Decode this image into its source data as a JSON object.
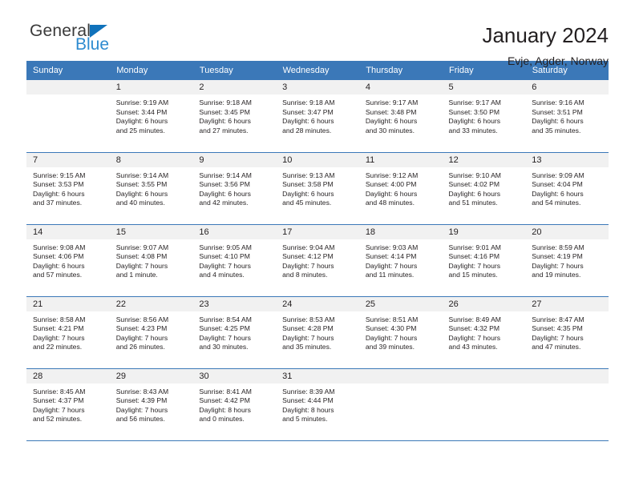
{
  "brand": {
    "name_part1": "General",
    "name_part2": "Blue",
    "triangle_icon": "triangle-icon",
    "accent_color": "#1072bb",
    "text_color": "#2e8bd0"
  },
  "header": {
    "title": "January 2024",
    "subtitle": "Evje, Agder, Norway"
  },
  "calendar": {
    "header_bg": "#3b78b8",
    "daynum_bg": "#f1f1f1",
    "weekdays": [
      "Sunday",
      "Monday",
      "Tuesday",
      "Wednesday",
      "Thursday",
      "Friday",
      "Saturday"
    ],
    "weeks": [
      [
        {
          "day": "",
          "blank": true,
          "sunrise": "",
          "sunset": "",
          "daylight1": "",
          "daylight2": ""
        },
        {
          "day": "1",
          "sunrise": "Sunrise: 9:19 AM",
          "sunset": "Sunset: 3:44 PM",
          "daylight1": "Daylight: 6 hours",
          "daylight2": "and 25 minutes."
        },
        {
          "day": "2",
          "sunrise": "Sunrise: 9:18 AM",
          "sunset": "Sunset: 3:45 PM",
          "daylight1": "Daylight: 6 hours",
          "daylight2": "and 27 minutes."
        },
        {
          "day": "3",
          "sunrise": "Sunrise: 9:18 AM",
          "sunset": "Sunset: 3:47 PM",
          "daylight1": "Daylight: 6 hours",
          "daylight2": "and 28 minutes."
        },
        {
          "day": "4",
          "sunrise": "Sunrise: 9:17 AM",
          "sunset": "Sunset: 3:48 PM",
          "daylight1": "Daylight: 6 hours",
          "daylight2": "and 30 minutes."
        },
        {
          "day": "5",
          "sunrise": "Sunrise: 9:17 AM",
          "sunset": "Sunset: 3:50 PM",
          "daylight1": "Daylight: 6 hours",
          "daylight2": "and 33 minutes."
        },
        {
          "day": "6",
          "sunrise": "Sunrise: 9:16 AM",
          "sunset": "Sunset: 3:51 PM",
          "daylight1": "Daylight: 6 hours",
          "daylight2": "and 35 minutes."
        }
      ],
      [
        {
          "day": "7",
          "sunrise": "Sunrise: 9:15 AM",
          "sunset": "Sunset: 3:53 PM",
          "daylight1": "Daylight: 6 hours",
          "daylight2": "and 37 minutes."
        },
        {
          "day": "8",
          "sunrise": "Sunrise: 9:14 AM",
          "sunset": "Sunset: 3:55 PM",
          "daylight1": "Daylight: 6 hours",
          "daylight2": "and 40 minutes."
        },
        {
          "day": "9",
          "sunrise": "Sunrise: 9:14 AM",
          "sunset": "Sunset: 3:56 PM",
          "daylight1": "Daylight: 6 hours",
          "daylight2": "and 42 minutes."
        },
        {
          "day": "10",
          "sunrise": "Sunrise: 9:13 AM",
          "sunset": "Sunset: 3:58 PM",
          "daylight1": "Daylight: 6 hours",
          "daylight2": "and 45 minutes."
        },
        {
          "day": "11",
          "sunrise": "Sunrise: 9:12 AM",
          "sunset": "Sunset: 4:00 PM",
          "daylight1": "Daylight: 6 hours",
          "daylight2": "and 48 minutes."
        },
        {
          "day": "12",
          "sunrise": "Sunrise: 9:10 AM",
          "sunset": "Sunset: 4:02 PM",
          "daylight1": "Daylight: 6 hours",
          "daylight2": "and 51 minutes."
        },
        {
          "day": "13",
          "sunrise": "Sunrise: 9:09 AM",
          "sunset": "Sunset: 4:04 PM",
          "daylight1": "Daylight: 6 hours",
          "daylight2": "and 54 minutes."
        }
      ],
      [
        {
          "day": "14",
          "sunrise": "Sunrise: 9:08 AM",
          "sunset": "Sunset: 4:06 PM",
          "daylight1": "Daylight: 6 hours",
          "daylight2": "and 57 minutes."
        },
        {
          "day": "15",
          "sunrise": "Sunrise: 9:07 AM",
          "sunset": "Sunset: 4:08 PM",
          "daylight1": "Daylight: 7 hours",
          "daylight2": "and 1 minute."
        },
        {
          "day": "16",
          "sunrise": "Sunrise: 9:05 AM",
          "sunset": "Sunset: 4:10 PM",
          "daylight1": "Daylight: 7 hours",
          "daylight2": "and 4 minutes."
        },
        {
          "day": "17",
          "sunrise": "Sunrise: 9:04 AM",
          "sunset": "Sunset: 4:12 PM",
          "daylight1": "Daylight: 7 hours",
          "daylight2": "and 8 minutes."
        },
        {
          "day": "18",
          "sunrise": "Sunrise: 9:03 AM",
          "sunset": "Sunset: 4:14 PM",
          "daylight1": "Daylight: 7 hours",
          "daylight2": "and 11 minutes."
        },
        {
          "day": "19",
          "sunrise": "Sunrise: 9:01 AM",
          "sunset": "Sunset: 4:16 PM",
          "daylight1": "Daylight: 7 hours",
          "daylight2": "and 15 minutes."
        },
        {
          "day": "20",
          "sunrise": "Sunrise: 8:59 AM",
          "sunset": "Sunset: 4:19 PM",
          "daylight1": "Daylight: 7 hours",
          "daylight2": "and 19 minutes."
        }
      ],
      [
        {
          "day": "21",
          "sunrise": "Sunrise: 8:58 AM",
          "sunset": "Sunset: 4:21 PM",
          "daylight1": "Daylight: 7 hours",
          "daylight2": "and 22 minutes."
        },
        {
          "day": "22",
          "sunrise": "Sunrise: 8:56 AM",
          "sunset": "Sunset: 4:23 PM",
          "daylight1": "Daylight: 7 hours",
          "daylight2": "and 26 minutes."
        },
        {
          "day": "23",
          "sunrise": "Sunrise: 8:54 AM",
          "sunset": "Sunset: 4:25 PM",
          "daylight1": "Daylight: 7 hours",
          "daylight2": "and 30 minutes."
        },
        {
          "day": "24",
          "sunrise": "Sunrise: 8:53 AM",
          "sunset": "Sunset: 4:28 PM",
          "daylight1": "Daylight: 7 hours",
          "daylight2": "and 35 minutes."
        },
        {
          "day": "25",
          "sunrise": "Sunrise: 8:51 AM",
          "sunset": "Sunset: 4:30 PM",
          "daylight1": "Daylight: 7 hours",
          "daylight2": "and 39 minutes."
        },
        {
          "day": "26",
          "sunrise": "Sunrise: 8:49 AM",
          "sunset": "Sunset: 4:32 PM",
          "daylight1": "Daylight: 7 hours",
          "daylight2": "and 43 minutes."
        },
        {
          "day": "27",
          "sunrise": "Sunrise: 8:47 AM",
          "sunset": "Sunset: 4:35 PM",
          "daylight1": "Daylight: 7 hours",
          "daylight2": "and 47 minutes."
        }
      ],
      [
        {
          "day": "28",
          "sunrise": "Sunrise: 8:45 AM",
          "sunset": "Sunset: 4:37 PM",
          "daylight1": "Daylight: 7 hours",
          "daylight2": "and 52 minutes."
        },
        {
          "day": "29",
          "sunrise": "Sunrise: 8:43 AM",
          "sunset": "Sunset: 4:39 PM",
          "daylight1": "Daylight: 7 hours",
          "daylight2": "and 56 minutes."
        },
        {
          "day": "30",
          "sunrise": "Sunrise: 8:41 AM",
          "sunset": "Sunset: 4:42 PM",
          "daylight1": "Daylight: 8 hours",
          "daylight2": "and 0 minutes."
        },
        {
          "day": "31",
          "sunrise": "Sunrise: 8:39 AM",
          "sunset": "Sunset: 4:44 PM",
          "daylight1": "Daylight: 8 hours",
          "daylight2": "and 5 minutes."
        },
        {
          "day": "",
          "blank": true,
          "sunrise": "",
          "sunset": "",
          "daylight1": "",
          "daylight2": ""
        },
        {
          "day": "",
          "blank": true,
          "sunrise": "",
          "sunset": "",
          "daylight1": "",
          "daylight2": ""
        },
        {
          "day": "",
          "blank": true,
          "sunrise": "",
          "sunset": "",
          "daylight1": "",
          "daylight2": ""
        }
      ]
    ]
  }
}
